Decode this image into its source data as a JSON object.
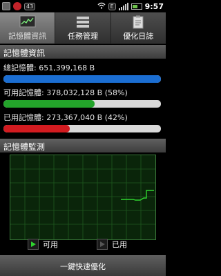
{
  "status_bar": {
    "sms_badge": "43",
    "time": "9:57",
    "icons": [
      "photo-icon",
      "flame-icon",
      "battery-saver-icon",
      "wifi-icon",
      "signal-icon",
      "battery-icon"
    ]
  },
  "tabs": [
    {
      "label": "記憶體資訊",
      "icon": "memory-chart-icon",
      "active": true
    },
    {
      "label": "任務管理",
      "icon": "task-list-icon",
      "active": false
    },
    {
      "label": "優化日誌",
      "icon": "clipboard-icon",
      "active": false
    }
  ],
  "memory_info": {
    "header": "記憶體資訊",
    "total": {
      "text": "總記憶體: 651,399,168 B",
      "fraction": 1.0,
      "color": "#1b6ed2"
    },
    "available": {
      "text": "可用記憶體: 378,032,128 B (58%)",
      "fraction": 0.58,
      "color": "#23a32a"
    },
    "used": {
      "text": "已用記憶體: 273,367,040 B (42%)",
      "fraction": 0.42,
      "color": "#d21b20"
    }
  },
  "monitor": {
    "header": "記憶體監測",
    "series": [
      {
        "name": "可用",
        "color": "#2fd42f"
      },
      {
        "name": "已用",
        "color": "#d21b20"
      }
    ]
  },
  "bottom_button": {
    "label": "一鍵快速優化"
  }
}
